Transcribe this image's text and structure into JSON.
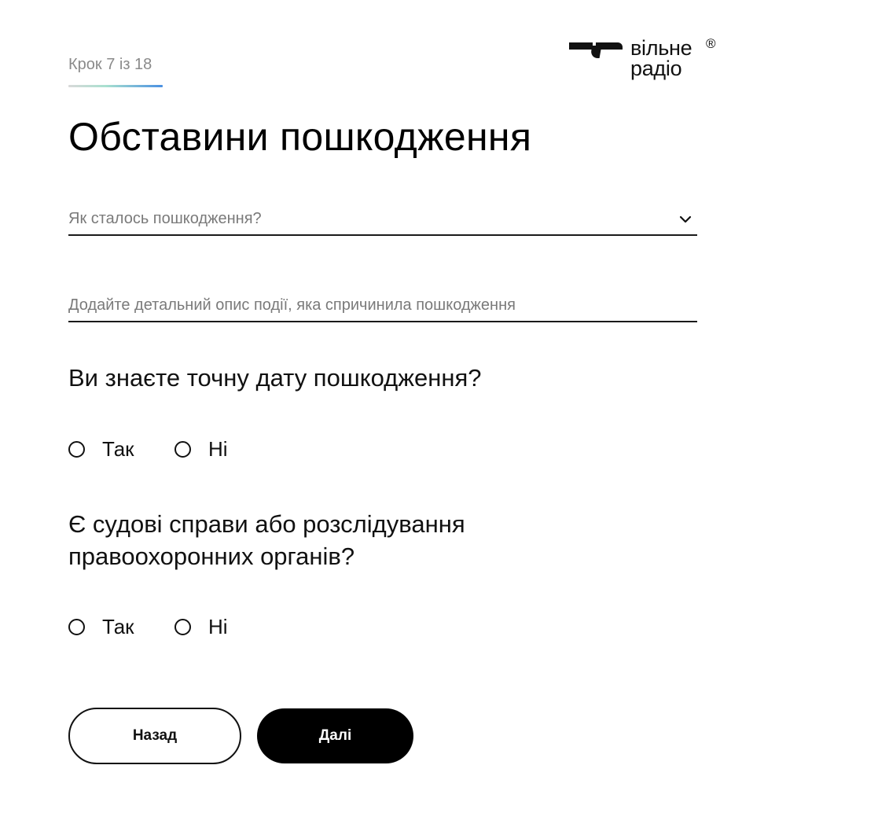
{
  "header": {
    "step_text": "Крок 7 із 18",
    "step_current": 7,
    "step_total": 18,
    "logo": {
      "line1": "вільне",
      "line2": "радіо",
      "registered_mark": "®"
    }
  },
  "page": {
    "title": "Обставини пошкодження"
  },
  "form": {
    "damage_cause": {
      "placeholder": "Як сталось пошкодження?",
      "icon": "chevron-down-icon"
    },
    "description": {
      "placeholder": "Додайте детальний опис події, яка спричинила пошкодження",
      "value": ""
    },
    "exact_date": {
      "question": "Ви знаєте точну дату пошкодження?",
      "options": [
        {
          "label": "Так",
          "selected": false
        },
        {
          "label": "Ні",
          "selected": false
        }
      ]
    },
    "court_cases": {
      "question": "Є судові справи або розслідування правоохоронних органів?",
      "options": [
        {
          "label": "Так",
          "selected": false
        },
        {
          "label": "Ні",
          "selected": false
        }
      ]
    }
  },
  "buttons": {
    "back_label": "Назад",
    "next_label": "Далі"
  },
  "colors": {
    "primary": "#000000",
    "text_muted": "#7a7a7a",
    "progress_gradient_end": "#4a90e2"
  }
}
